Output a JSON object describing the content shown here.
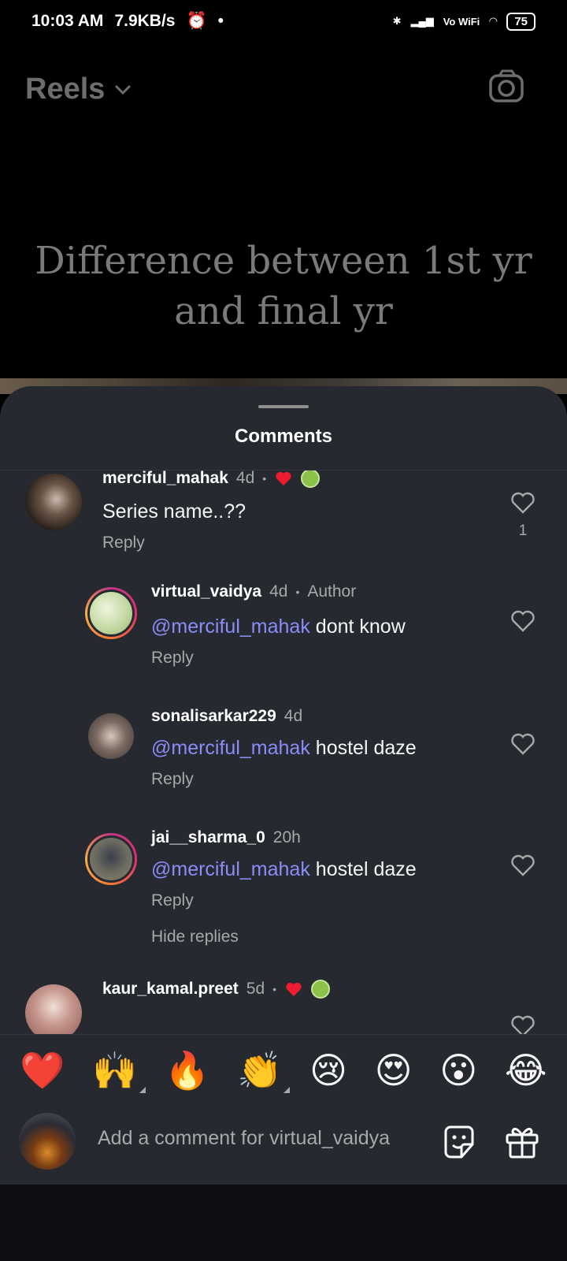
{
  "status_bar": {
    "time": "10:03 AM",
    "speed": "7.9KB/s",
    "network": "Vo WiFi",
    "battery": "75"
  },
  "reel": {
    "header_title": "Reels",
    "overlay_text": "Difference between 1st yr and final yr"
  },
  "sheet": {
    "title": "Comments"
  },
  "comments": [
    {
      "user": "merciful_mahak",
      "time": "4d",
      "text": "Series name..??",
      "reply": "Reply",
      "likes": "1"
    },
    {
      "user": "virtual_vaidya",
      "time": "4d",
      "author_label": "Author",
      "mention": "@merciful_mahak",
      "text": " dont know",
      "reply": "Reply"
    },
    {
      "user": "sonalisarkar229",
      "time": "4d",
      "mention": "@merciful_mahak",
      "text": " hostel daze",
      "reply": "Reply"
    },
    {
      "user": "jai__sharma_0",
      "time": "20h",
      "mention": "@merciful_mahak",
      "text": " hostel daze",
      "reply": "Reply"
    },
    {
      "user": "kaur_kamal.preet",
      "time": "5d"
    }
  ],
  "hide_replies": "Hide replies",
  "emojis": [
    "❤️",
    "🙌",
    "🔥",
    "👏",
    "😢",
    "😍",
    "😮",
    "😂"
  ],
  "input": {
    "placeholder": "Add a comment for virtual_vaidya"
  },
  "icons": {
    "camera": "camera-icon",
    "chevron": "chevron-down-icon",
    "heart": "heart-outline-icon",
    "sticker": "sticker-icon",
    "gift": "gift-icon"
  },
  "colors": {
    "sheet_bg": "#262a30",
    "mention": "#8b8cf7",
    "muted": "#a8a8a8"
  }
}
